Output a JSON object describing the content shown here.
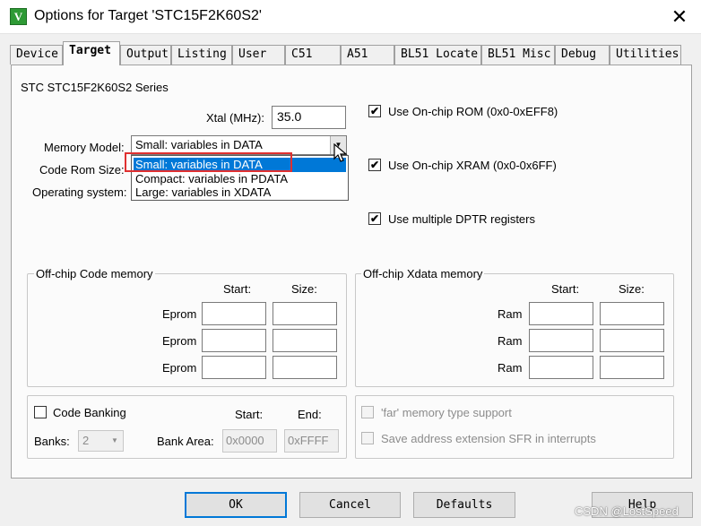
{
  "window": {
    "title": "Options for Target 'STC15F2K60S2'",
    "icon": "keil-uvision-icon",
    "close_label": "✕"
  },
  "tabs": [
    {
      "label": "Device"
    },
    {
      "label": "Target",
      "active": true
    },
    {
      "label": "Output"
    },
    {
      "label": "Listing"
    },
    {
      "label": "User"
    },
    {
      "label": "C51"
    },
    {
      "label": "A51"
    },
    {
      "label": "BL51 Locate"
    },
    {
      "label": "BL51 Misc"
    },
    {
      "label": "Debug"
    },
    {
      "label": "Utilities"
    }
  ],
  "target": {
    "series": "STC STC15F2K60S2 Series",
    "xtal_label": "Xtal (MHz):",
    "xtal_value": "35.0",
    "memory_model_label": "Memory Model:",
    "memory_model_value": "Small: variables in DATA",
    "code_rom_label": "Code Rom Size:",
    "os_label": "Operating system:",
    "memory_model_options": [
      {
        "label": "Small: variables in DATA",
        "selected": true
      },
      {
        "label": "Compact: variables in PDATA"
      },
      {
        "label": "Large: variables in XDATA"
      }
    ],
    "onchip_rom": {
      "label": "Use On-chip ROM (0x0-0xEFF8)",
      "checked": true
    },
    "onchip_xram": {
      "label": "Use On-chip XRAM (0x0-0x6FF)",
      "checked": true
    },
    "multi_dptr": {
      "label": "Use multiple DPTR registers",
      "checked": true
    }
  },
  "offchip_code": {
    "title": "Off-chip Code memory",
    "start_label": "Start:",
    "size_label": "Size:",
    "rows": [
      {
        "label": "Eprom"
      },
      {
        "label": "Eprom"
      },
      {
        "label": "Eprom"
      }
    ]
  },
  "offchip_xdata": {
    "title": "Off-chip Xdata memory",
    "start_label": "Start:",
    "size_label": "Size:",
    "rows": [
      {
        "label": "Ram"
      },
      {
        "label": "Ram"
      },
      {
        "label": "Ram"
      }
    ]
  },
  "banking": {
    "code_banking_label": "Code Banking",
    "code_banking_checked": false,
    "start_label": "Start:",
    "end_label": "End:",
    "banks_label": "Banks:",
    "banks_value": "2",
    "bank_area_label": "Bank Area:",
    "bank_area_start": "0x0000",
    "bank_area_end": "0xFFFF"
  },
  "far_options": {
    "far_memory_label": "'far' memory type support",
    "save_address_label": "Save address extension SFR in interrupts"
  },
  "buttons": {
    "ok": "OK",
    "cancel": "Cancel",
    "defaults": "Defaults",
    "help": "Help"
  },
  "watermark": "CSDN @LostSpeed",
  "colors": {
    "selection": "#0078d7",
    "highlight_box": "#e03030",
    "check_accent": "#000000"
  }
}
